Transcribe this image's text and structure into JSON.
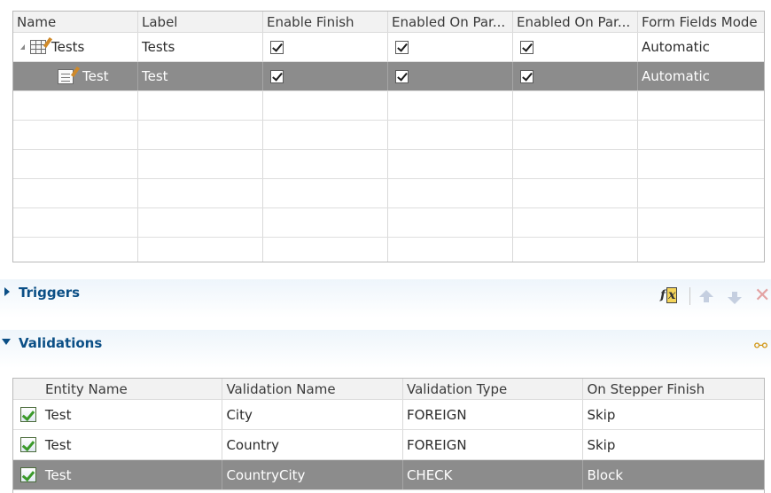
{
  "steps_grid": {
    "columns": [
      "Name",
      "Label",
      "Enable Finish",
      "Enabled On Par...",
      "Enabled On Par...",
      "Form Fields Mode"
    ],
    "rows": [
      {
        "name": "Tests",
        "label": "Tests",
        "enable_finish": true,
        "enabled_on_par_1": true,
        "enabled_on_par_2": true,
        "form_fields_mode": "Automatic",
        "selected": false,
        "icon": "table-icon"
      },
      {
        "name": "Test",
        "label": "Test",
        "enable_finish": true,
        "enabled_on_par_1": true,
        "enabled_on_par_2": true,
        "form_fields_mode": "Automatic",
        "selected": true,
        "icon": "form-icon"
      }
    ]
  },
  "triggers": {
    "title": "Triggers",
    "expanded": false
  },
  "validations": {
    "title": "Validations",
    "expanded": true,
    "columns": [
      "Entity Name",
      "Validation Name",
      "Validation Type",
      "On Stepper Finish"
    ],
    "rows": [
      {
        "entity": "Test",
        "name": "City",
        "type": "FOREIGN",
        "finish": "Skip",
        "selected": false
      },
      {
        "entity": "Test",
        "name": "Country",
        "type": "FOREIGN",
        "finish": "Skip",
        "selected": false
      },
      {
        "entity": "Test",
        "name": "CountryCity",
        "type": "CHECK",
        "finish": "Block",
        "selected": true
      }
    ]
  },
  "colors": {
    "accent": "#0b4f86",
    "selection": "#8c8c8c"
  }
}
